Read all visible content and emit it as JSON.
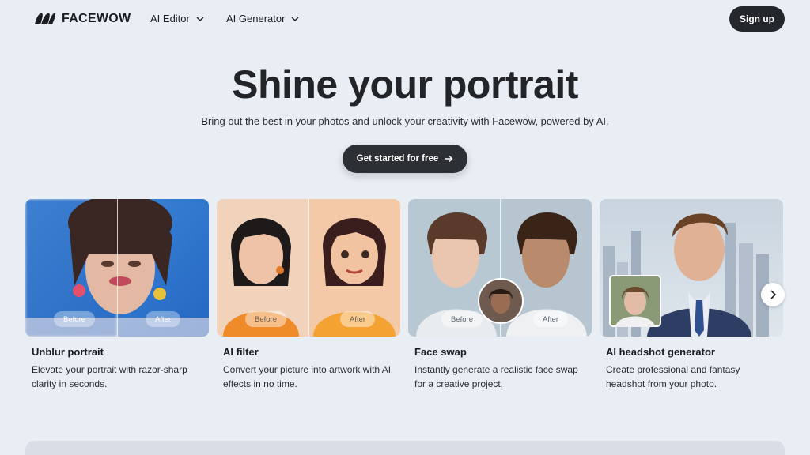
{
  "nav": {
    "logo_text": "FACEWOW",
    "ai_editor": "AI Editor",
    "ai_generator": "AI Generator",
    "signup": "Sign up"
  },
  "hero": {
    "title": "Shine your portrait",
    "subtitle": "Bring out the best in your photos and unlock your creativity with Facewow, powered by AI.",
    "cta": "Get started for free"
  },
  "cards": [
    {
      "title": "Unblur portrait",
      "desc": "Elevate your portrait with razor-sharp clarity in seconds.",
      "before": "Before",
      "after": "After"
    },
    {
      "title": "AI filter",
      "desc": "Convert your picture into artwork with AI effects in no time.",
      "before": "Before",
      "after": "After"
    },
    {
      "title": "Face swap",
      "desc": "Instantly generate a realistic face swap for a creative project.",
      "before": "Before",
      "after": "After"
    },
    {
      "title": "AI headshot generator",
      "desc": "Create professional and fantasy headshot from your photo."
    }
  ],
  "colors": {
    "background": "#e9edf4",
    "dark_button": "#24272b",
    "text": "#1c1d20"
  },
  "icons": {
    "logo": "facewow-logo-icon",
    "dropdown": "chevron-down-icon",
    "cta_arrow": "arrow-right-icon",
    "carousel_next": "chevron-right-icon"
  }
}
